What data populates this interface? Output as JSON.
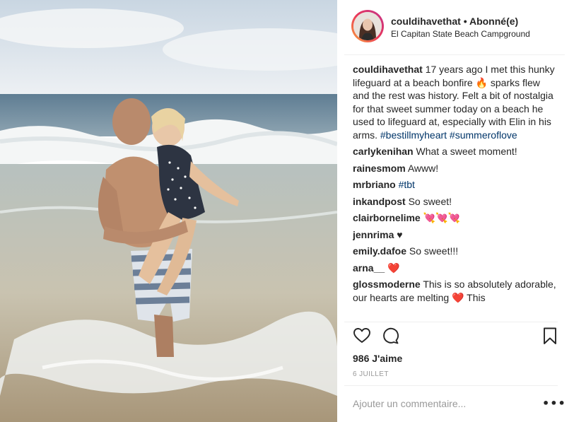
{
  "header": {
    "username": "couldihavethat",
    "separator": "•",
    "follow_status": "Abonné(e)",
    "location": "El Capitan State Beach Campground"
  },
  "caption": {
    "username": "couldihavethat",
    "text": "17 years ago I met this hunky lifeguard at a beach bonfire 🔥 sparks flew and the rest was history. Felt a bit of nostalgia for that sweet summer today on a beach he used to lifeguard at, especially with Elin in his arms.",
    "hashtags": "#bestillmyheart #summeroflove"
  },
  "comments": [
    {
      "user": "carlykenihan",
      "text": "What a sweet moment!"
    },
    {
      "user": "rainesmom",
      "text": "Awww!"
    },
    {
      "user": "mrbriano",
      "text": "#tbt"
    },
    {
      "user": "inkandpost",
      "text": "So sweet!"
    },
    {
      "user": "clairbornelime",
      "text": "💘💘💘"
    },
    {
      "user": "jennrima",
      "text": "♥"
    },
    {
      "user": "emily.dafoe",
      "text": "So sweet!!!"
    },
    {
      "user": "arna__",
      "text": "❤️"
    },
    {
      "user": "glossmoderne",
      "text": "This is so absolutely adorable, our hearts are melting ❤️ This"
    }
  ],
  "likes_label": "986 J'aime",
  "date_label": "6 JUILLET",
  "add_comment_placeholder": "Ajouter un commentaire...",
  "more_label": "•••",
  "icons": {
    "like": "heart-icon",
    "comment": "comment-bubble-icon",
    "save": "bookmark-icon"
  },
  "colors": {
    "link": "#003569",
    "muted": "#999999",
    "text": "#262626",
    "story_ring_start": "#f9a33a",
    "story_ring_end": "#c2348c"
  }
}
